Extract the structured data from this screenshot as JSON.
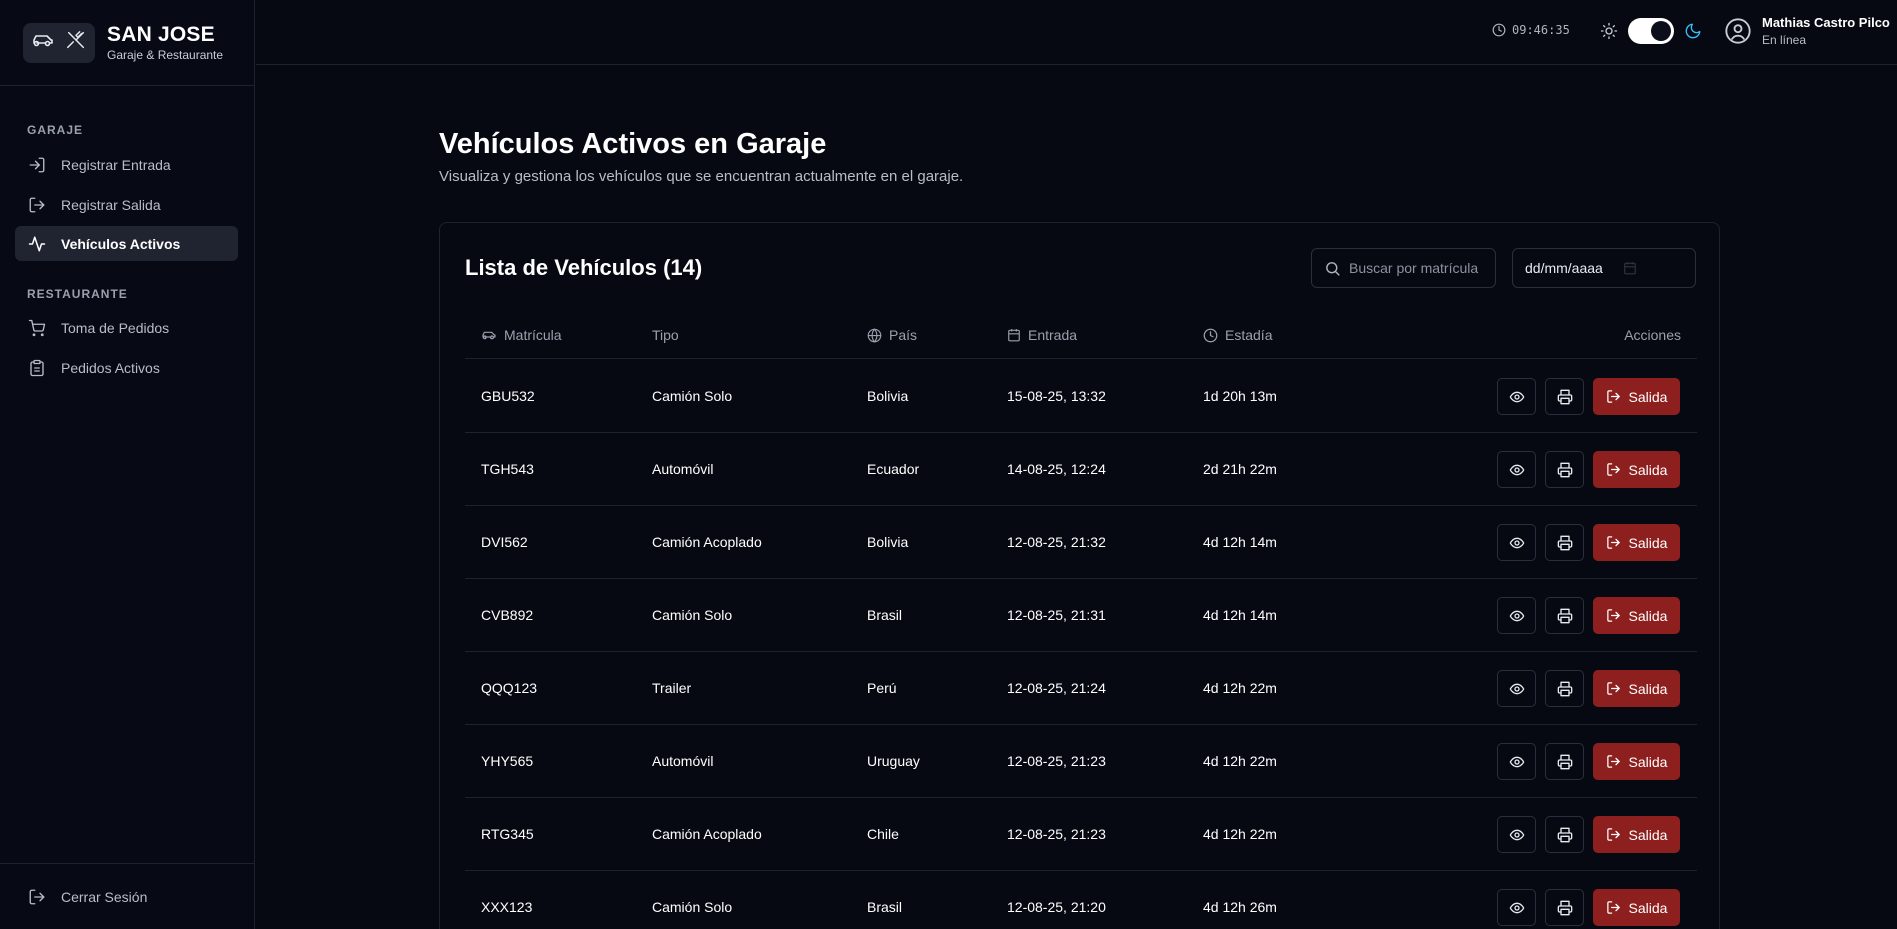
{
  "brand": {
    "title": "SAN JOSE",
    "subtitle": "Garaje & Restaurante"
  },
  "sidebar": {
    "sections": [
      {
        "label": "GARAJE"
      },
      {
        "label": "RESTAURANTE"
      }
    ],
    "items": [
      {
        "label": "Registrar Entrada",
        "icon": "login-icon"
      },
      {
        "label": "Registrar Salida",
        "icon": "logout-icon"
      },
      {
        "label": "Vehículos Activos",
        "icon": "activity-icon",
        "active": true
      },
      {
        "label": "Toma de Pedidos",
        "icon": "cart-icon"
      },
      {
        "label": "Pedidos Activos",
        "icon": "clipboard-icon"
      }
    ],
    "logout_label": "Cerrar Sesión"
  },
  "header": {
    "clock": "09:46:35",
    "user_name": "Mathias Castro Pilco",
    "user_status": "En línea",
    "theme_mode": "dark"
  },
  "main": {
    "title": "Vehículos Activos en Garaje",
    "subtitle": "Visualiza y gestiona los vehículos que se encuentran actualmente en el garaje."
  },
  "table": {
    "title": "Lista de Vehículos (14)",
    "search_placeholder": "Buscar por matrícula",
    "date_placeholder": "dd/mm/aaaa",
    "columns": {
      "plate": "Matrícula",
      "type": "Tipo",
      "country": "País",
      "entry": "Entrada",
      "stay": "Estadía",
      "actions": "Acciones"
    },
    "exit_label": "Salida",
    "rows": [
      {
        "plate": "GBU532",
        "type": "Camión Solo",
        "country": "Bolivia",
        "entry": "15-08-25, 13:32",
        "stay": "1d 20h 13m"
      },
      {
        "plate": "TGH543",
        "type": "Automóvil",
        "country": "Ecuador",
        "entry": "14-08-25, 12:24",
        "stay": "2d 21h 22m"
      },
      {
        "plate": "DVI562",
        "type": "Camión Acoplado",
        "country": "Bolivia",
        "entry": "12-08-25, 21:32",
        "stay": "4d 12h 14m"
      },
      {
        "plate": "CVB892",
        "type": "Camión Solo",
        "country": "Brasil",
        "entry": "12-08-25, 21:31",
        "stay": "4d 12h 14m"
      },
      {
        "plate": "QQQ123",
        "type": "Trailer",
        "country": "Perú",
        "entry": "12-08-25, 21:24",
        "stay": "4d 12h 22m"
      },
      {
        "plate": "YHY565",
        "type": "Automóvil",
        "country": "Uruguay",
        "entry": "12-08-25, 21:23",
        "stay": "4d 12h 22m"
      },
      {
        "plate": "RTG345",
        "type": "Camión Acoplado",
        "country": "Chile",
        "entry": "12-08-25, 21:23",
        "stay": "4d 12h 22m"
      },
      {
        "plate": "XXX123",
        "type": "Camión Solo",
        "country": "Brasil",
        "entry": "12-08-25, 21:20",
        "stay": "4d 12h 26m"
      }
    ]
  }
}
